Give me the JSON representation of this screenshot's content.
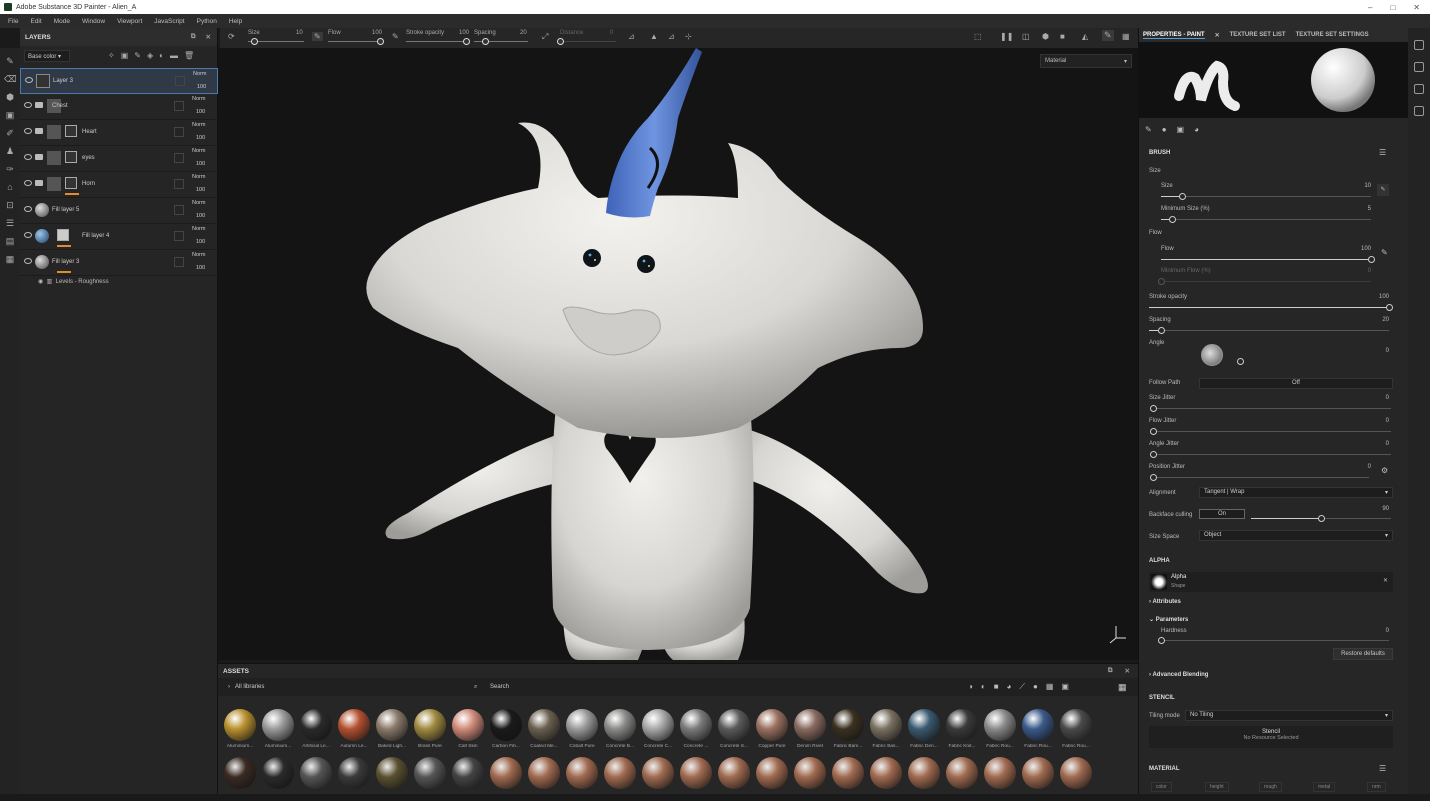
{
  "window": {
    "title": "Adobe Substance 3D Painter - Alien_A"
  },
  "menu": [
    "File",
    "Edit",
    "Mode",
    "Window",
    "Viewport",
    "JavaScript",
    "Python",
    "Help"
  ],
  "toolbar": {
    "size_label": "Size",
    "size_value": "10",
    "size_level": 0.1,
    "flow_label": "Flow",
    "flow_value": "100",
    "flow_level": 1.0,
    "stroke_opacity_label": "Stroke opacity",
    "stroke_opacity_value": "100",
    "stroke_opacity_level": 1.0,
    "spacing_label": "Spacing",
    "spacing_value": "20",
    "spacing_level": 0.2,
    "distance_label": "Distance",
    "distance_value": "0",
    "distance_level": 0.0
  },
  "layers": {
    "title": "LAYERS",
    "channel": "Base color",
    "items": [
      {
        "name": "Layer 3",
        "blend": "Norm",
        "opacity": "100",
        "kind": "paint"
      },
      {
        "name": "Chest",
        "blend": "Norm",
        "opacity": "100",
        "kind": "folder"
      },
      {
        "name": "Heart",
        "blend": "Norm",
        "opacity": "100",
        "kind": "folder-mask"
      },
      {
        "name": "eyes",
        "blend": "Norm",
        "opacity": "100",
        "kind": "folder-mask"
      },
      {
        "name": "Horn",
        "blend": "Norm",
        "opacity": "100",
        "kind": "folder-mask"
      },
      {
        "name": "Fill layer 5",
        "blend": "Norm",
        "opacity": "100",
        "kind": "fill"
      },
      {
        "name": "Fill layer 4",
        "blend": "Norm",
        "opacity": "100",
        "kind": "fill-mask"
      },
      {
        "name": "Fill layer 3",
        "blend": "Norm",
        "opacity": "100",
        "kind": "fill"
      }
    ],
    "effect": "Levels - Roughness"
  },
  "viewport": {
    "mode": "Material"
  },
  "assets": {
    "title": "ASSETS",
    "library": "All libraries",
    "search_placeholder": "Search",
    "materials": [
      {
        "name": "Aluminium...",
        "color": "#b8902e"
      },
      {
        "name": "Aluminium...",
        "color": "#9a9a9a"
      },
      {
        "name": "Artificial Le...",
        "color": "#2a2a2a"
      },
      {
        "name": "Autumn Le...",
        "color": "#b35030"
      },
      {
        "name": "Baked Ligh...",
        "color": "#8a7a6a"
      },
      {
        "name": "Brass Pure",
        "color": "#a08a40"
      },
      {
        "name": "Calf Skin",
        "color": "#d08a7a"
      },
      {
        "name": "Carbon Fib...",
        "color": "#1a1a1a"
      },
      {
        "name": "Coated Me...",
        "color": "#6a6050"
      },
      {
        "name": "Cobalt Pure",
        "color": "#9a9a9a"
      },
      {
        "name": "Concrete B...",
        "color": "#8a8a88"
      },
      {
        "name": "Concrete C...",
        "color": "#a8a8a8"
      },
      {
        "name": "Concrete ...",
        "color": "#7a7a7a"
      },
      {
        "name": "Concrete S...",
        "color": "#5a5a5a"
      },
      {
        "name": "Copper Pure",
        "color": "#9a7060"
      },
      {
        "name": "Denim Rivet",
        "color": "#8a6a60"
      },
      {
        "name": "Fabric Bam...",
        "color": "#3a3020"
      },
      {
        "name": "Fabric Bas...",
        "color": "#7a7060"
      },
      {
        "name": "Fabric Den...",
        "color": "#3a5a70"
      },
      {
        "name": "Fabric Knit...",
        "color": "#3a3a3a"
      },
      {
        "name": "Fabric Rou...",
        "color": "#8a8a8a"
      },
      {
        "name": "Fabric Rou...",
        "color": "#3a5a8a"
      },
      {
        "name": "Fabric Rou...",
        "color": "#4a4a4a"
      }
    ],
    "row2_colors": [
      "#3a2a22",
      "#2a2a2a",
      "#555555",
      "#3a3a3a",
      "#5a5030",
      "#555555",
      "#444444",
      "#a06a50",
      "#a06a50",
      "#a06a50",
      "#a06a50",
      "#a06a50",
      "#a06a50",
      "#a06a50",
      "#a06a50",
      "#a06a50",
      "#a06a50",
      "#a06a50",
      "#a06a50",
      "#a06a50",
      "#a06a50",
      "#a06a50",
      "#a06a50"
    ]
  },
  "properties": {
    "tabs": [
      "PROPERTIES - PAINT",
      "TEXTURE SET LIST",
      "TEXTURE SET SETTINGS"
    ],
    "brush_header": "BRUSH",
    "size_group": "Size",
    "size_label": "Size",
    "size_value": "10",
    "size_level": 0.1,
    "min_size_label": "Minimum Size (%)",
    "min_size_value": "5",
    "min_size_level": 0.05,
    "flow_group": "Flow",
    "flow_label": "Flow",
    "flow_value": "100",
    "flow_level": 1.0,
    "min_flow_label": "Minimum Flow (%)",
    "min_flow_value": "0",
    "min_flow_level": 0.0,
    "stroke_opacity_label": "Stroke opacity",
    "stroke_opacity_value": "100",
    "stroke_opacity_level": 1.0,
    "spacing_label": "Spacing",
    "spacing_value": "20",
    "spacing_level": 0.05,
    "angle_label": "Angle",
    "angle_value": "0",
    "follow_path_label": "Follow Path",
    "follow_path_value": "Off",
    "size_jitter_label": "Size Jitter",
    "size_jitter_value": "0",
    "flow_jitter_label": "Flow Jitter",
    "flow_jitter_value": "0",
    "angle_jitter_label": "Angle Jitter",
    "angle_jitter_value": "0",
    "position_jitter_label": "Position Jitter",
    "position_jitter_value": "0",
    "alignment_label": "Alignment",
    "alignment_value": "Tangent | Wrap",
    "backface_label": "Backface culling",
    "backface_value": "On",
    "backface_angle": "90",
    "backface_level": 0.5,
    "size_space_label": "Size Space",
    "size_space_value": "Object",
    "alpha_header": "ALPHA",
    "alpha_name": "Alpha",
    "alpha_type": "Shape",
    "attributes_label": "Attributes",
    "parameters_label": "Parameters",
    "hardness_label": "Hardness",
    "hardness_value": "0",
    "restore_label": "Restore defaults",
    "adv_blending_label": "Advanced Blending",
    "stencil_header": "STENCIL",
    "tiling_label": "Tiling mode",
    "tiling_value": "No Tiling",
    "stencil_label": "Stencil",
    "stencil_sub": "No Resource Selected",
    "material_header": "MATERIAL",
    "material_channels": [
      "color",
      "height",
      "rough",
      "metal",
      "nrm"
    ]
  }
}
